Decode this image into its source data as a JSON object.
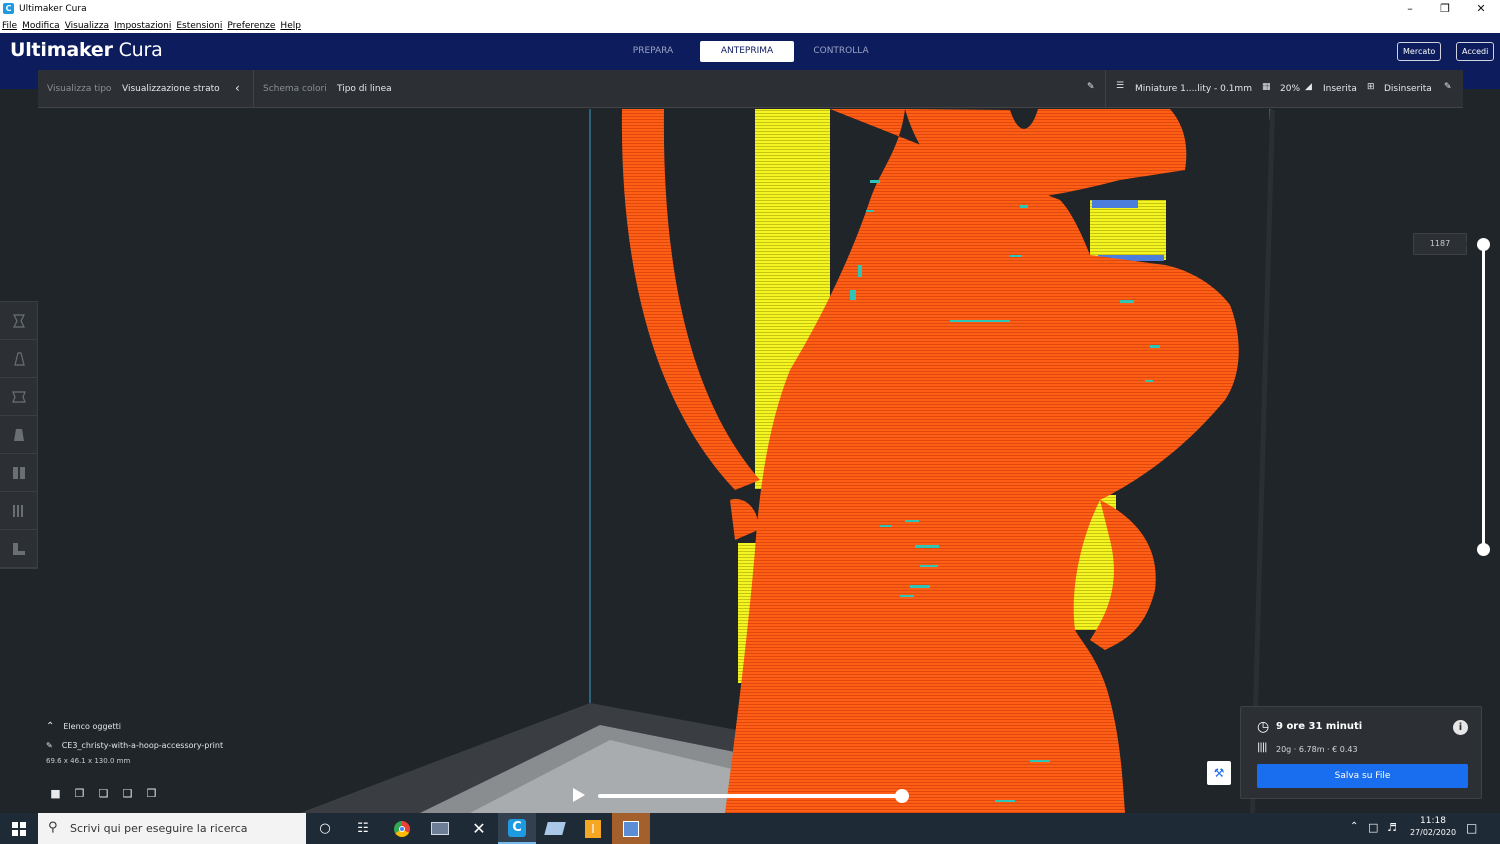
{
  "window": {
    "title": "Ultimaker Cura",
    "app_icon": "C"
  },
  "menu": [
    "File",
    "Modifica",
    "Visualizza",
    "Impostazioni",
    "Estensioni",
    "Preferenze",
    "Help"
  ],
  "header": {
    "logo_bold": "Ultimaker",
    "logo_thin": " Cura",
    "stages": [
      "PREPARA",
      "ANTEPRIMA",
      "CONTROLLA"
    ],
    "active_stage": "ANTEPRIMA",
    "marketplace": "Mercato",
    "signin": "Accedi"
  },
  "toolbar": {
    "view_type_label": "Visualizza tipo",
    "view_type_value": "Visualizzazione strato",
    "color_scheme_label": "Schema colori",
    "color_scheme_value": "Tipo di linea",
    "profile": "Miniature 1....lity - 0.1mm",
    "infill": "20%",
    "support": "Inserita",
    "adhesion": "Disinserita"
  },
  "layer_slider": {
    "current_layer": "1187",
    "level": 1.0
  },
  "object_list": {
    "title": "Elenco oggetti",
    "object_name": "CE3_christy-with-a-hoop-accessory-print",
    "dimensions": "69.6 x 46.1 x 130.0 mm"
  },
  "simulation": {
    "progress": 1.0
  },
  "print_info": {
    "time": "9 ore 31 minuti",
    "material": "20g · 6.78m · € 0.43",
    "save_button": "Salva su File"
  },
  "taskbar": {
    "search_placeholder": "Scrivi qui per eseguire la ricerca",
    "time": "11:18",
    "date": "27/02/2020"
  },
  "colors": {
    "header": "#0c1c5c",
    "model_wall": "#ff5e17",
    "support": "#ffff2e",
    "skin": "#4c7ddd",
    "infill_spots": "#2ec4b6",
    "accent": "#196ef0"
  }
}
